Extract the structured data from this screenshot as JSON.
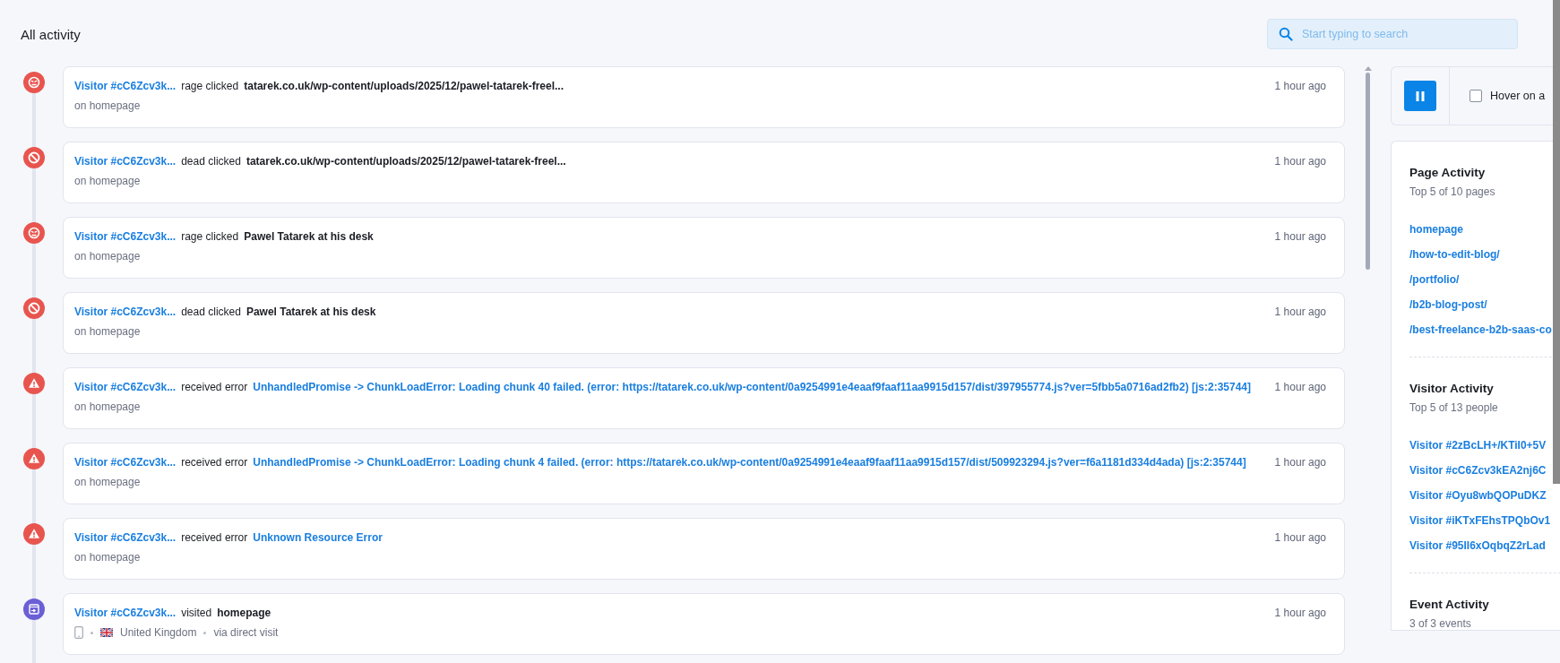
{
  "header": {
    "title": "All activity",
    "search": {
      "placeholder": "Start typing to search"
    }
  },
  "events": [
    {
      "kind": "rage",
      "visitor": "Visitor #cC6Zcv3k...",
      "action": "rage clicked",
      "target": "tatarek.co.uk/wp-content/uploads/2025/12/pawel-tatarek-freel...",
      "time": "1 hour ago",
      "page": "on homepage"
    },
    {
      "kind": "dead",
      "visitor": "Visitor #cC6Zcv3k...",
      "action": "dead clicked",
      "target": "tatarek.co.uk/wp-content/uploads/2025/12/pawel-tatarek-freel...",
      "time": "1 hour ago",
      "page": "on homepage"
    },
    {
      "kind": "rage",
      "visitor": "Visitor #cC6Zcv3k...",
      "action": "rage clicked",
      "target": "Pawel Tatarek at his desk",
      "time": "1 hour ago",
      "page": "on homepage"
    },
    {
      "kind": "dead",
      "visitor": "Visitor #cC6Zcv3k...",
      "action": "dead clicked",
      "target": "Pawel Tatarek at his desk",
      "time": "1 hour ago",
      "page": "on homepage"
    },
    {
      "kind": "error",
      "visitor": "Visitor #cC6Zcv3k...",
      "action": "received error",
      "target": "UnhandledPromise -> ChunkLoadError: Loading chunk 40 failed. (error: https://tatarek.co.uk/wp-content/0a9254991e4eaaf9faaf11aa9915d157/dist/397955774.js?ver=5fbb5a0716ad2fb2) [js:2:35744]",
      "time": "1 hour ago",
      "page": "on homepage"
    },
    {
      "kind": "error",
      "visitor": "Visitor #cC6Zcv3k...",
      "action": "received error",
      "target": "UnhandledPromise -> ChunkLoadError: Loading chunk 4 failed. (error: https://tatarek.co.uk/wp-content/0a9254991e4eaaf9faaf11aa9915d157/dist/509923294.js?ver=f6a1181d334d4ada) [js:2:35744]",
      "time": "1 hour ago",
      "page": "on homepage"
    },
    {
      "kind": "error",
      "visitor": "Visitor #cC6Zcv3k...",
      "action": "received error",
      "target": "Unknown Resource Error",
      "time": "1 hour ago",
      "page": "on homepage"
    },
    {
      "kind": "visit",
      "visitor": "Visitor #cC6Zcv3k...",
      "action": "visited",
      "target": "homepage",
      "time": "1 hour ago",
      "country": "United Kingdom",
      "source": "via direct visit"
    }
  ],
  "controls": {
    "hover_option": {
      "label": "Hover on a",
      "checked": false
    }
  },
  "panels": [
    {
      "title": "Page Activity",
      "subtitle": "Top 5 of 10 pages",
      "links": [
        "homepage",
        "/how-to-edit-blog/",
        "/portfolio/",
        "/b2b-blog-post/",
        "/best-freelance-b2b-saas-co"
      ]
    },
    {
      "title": "Visitor Activity",
      "subtitle": "Top 5 of 13 people",
      "links": [
        "Visitor #2zBcLH+/KTiI0+5V",
        "Visitor #cC6Zcv3kEA2nj6C",
        "Visitor #Oyu8wbQOPuDKZ",
        "Visitor #iKTxFEhsTPQbOv1",
        "Visitor #95II6xOqbqZ2rLad"
      ]
    },
    {
      "title": "Event Activity",
      "subtitle": "3 of 3 events"
    }
  ]
}
